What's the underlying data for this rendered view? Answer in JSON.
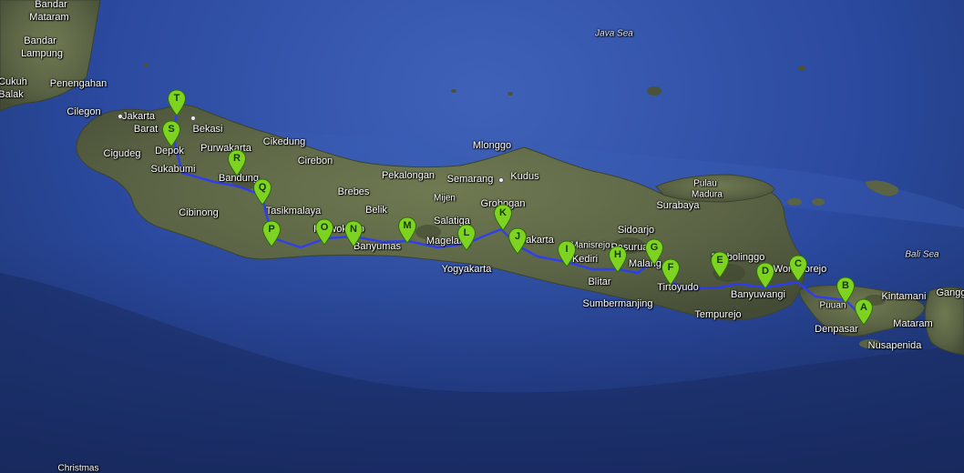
{
  "map": {
    "type": "satellite",
    "colors": {
      "sea": "#2b4aa0",
      "land": "#5f6a48",
      "route": "#2b3bff",
      "marker_fill": "#7ed321",
      "marker_stroke": "#2f6b0a"
    }
  },
  "labels": {
    "bandar_top": "Bandar",
    "mataram_top": "Mataram",
    "bandar_lampung_1": "Bandar",
    "bandar_lampung_2": "Lampung",
    "cukuh": "Cukuh",
    "balak": "Balak",
    "penengahan": "Penengahan",
    "cilegon": "Cilegon",
    "jakarta": "Jakarta",
    "barat": "Barat",
    "bekasi": "Bekasi",
    "depok": "Depok",
    "cigudeg": "Cigudeg",
    "purwakarta": "Purwakarta",
    "cikedung": "Cikedung",
    "sukabumi": "Sukabumi",
    "bandung": "Bandung",
    "cirebon": "Cirebon",
    "brebes": "Brebes",
    "pekalongan": "Pekalongan",
    "semarang": "Semarang",
    "kudus": "Kudus",
    "mlonggo": "Mlonggo",
    "java_sea": "Java Sea",
    "cibinong": "Cibinong",
    "tasikmalaya": "Tasikmalaya",
    "belik": "Belik",
    "mijen": "Mijen",
    "grobogan": "Grobogan",
    "salatiga": "Salatiga",
    "magelang": "Magelang",
    "surakarta": "Surakarta",
    "purwokerto": "Purwokerto",
    "banyumas": "Banyumas",
    "yogyakarta": "Yogyakarta",
    "manisrejo": "Manisrejo",
    "kediri": "Kediri",
    "blitar": "Blitar",
    "sumbermanjing": "Sumbermanjing",
    "surabaya": "Surabaya",
    "sidoarjo": "Sidoarjo",
    "pasuruan": "Pasuruan",
    "malang": "Malang",
    "tirtoyudo": "Tirtoyudo",
    "pulau_madura_1": "Pulau",
    "pulau_madura_2": "Madura",
    "probolinggo": "Probolinggo",
    "wongsorejo": "Wongsorejo",
    "banyuwangi": "Banyuwangi",
    "tempurejo": "Tempurejo",
    "bali_sea": "Bali Sea",
    "kintamani": "Kintamani",
    "gangga": "Gangg",
    "mataram": "Mataram",
    "denpasar": "Denpasar",
    "nusapenida": "Nusapenida",
    "pujuan": "Puuan",
    "christmas": "Christmas"
  },
  "markers": [
    {
      "letter": "A"
    },
    {
      "letter": "B"
    },
    {
      "letter": "C"
    },
    {
      "letter": "D"
    },
    {
      "letter": "E"
    },
    {
      "letter": "F"
    },
    {
      "letter": "G"
    },
    {
      "letter": "H"
    },
    {
      "letter": "I"
    },
    {
      "letter": "J"
    },
    {
      "letter": "K"
    },
    {
      "letter": "L"
    },
    {
      "letter": "M"
    },
    {
      "letter": "N"
    },
    {
      "letter": "O"
    },
    {
      "letter": "P"
    },
    {
      "letter": "Q"
    },
    {
      "letter": "R"
    },
    {
      "letter": "S"
    },
    {
      "letter": "T"
    }
  ]
}
